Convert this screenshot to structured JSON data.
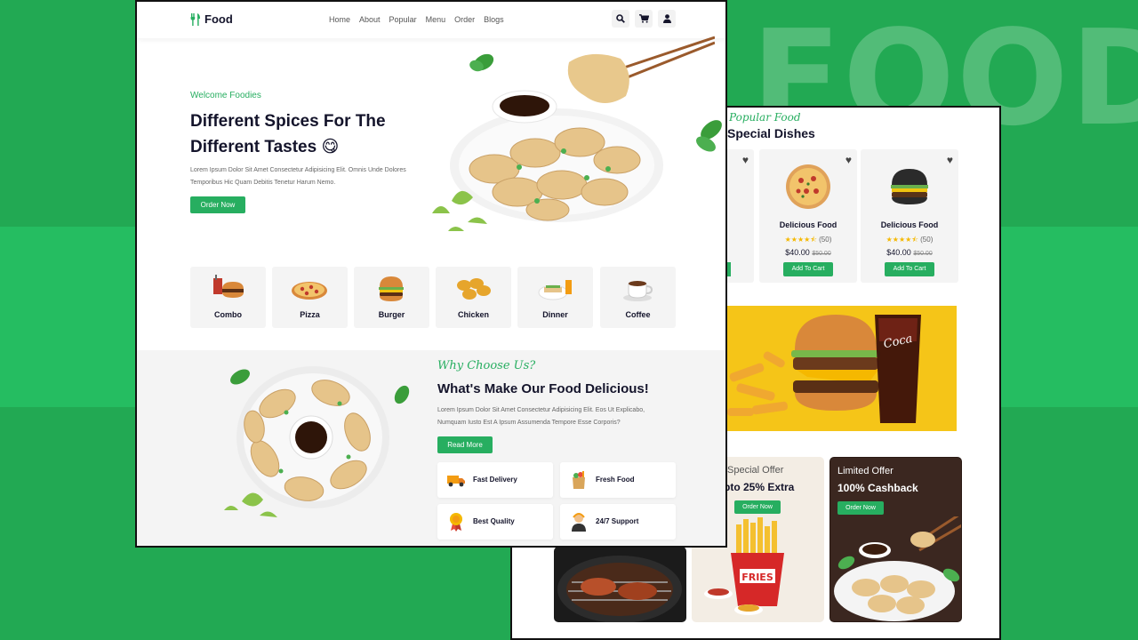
{
  "background": {
    "word": "FOOD",
    "accent": "#27ae60"
  },
  "nav": {
    "logo": "Food",
    "links": [
      "Home",
      "About",
      "Popular",
      "Menu",
      "Order",
      "Blogs"
    ],
    "icons": [
      "search-icon",
      "cart-icon",
      "user-icon"
    ]
  },
  "hero": {
    "welcome": "Welcome Foodies",
    "title_line1": "Different Spices For The",
    "title_line2": "Different Tastes",
    "emoji": "😋",
    "description_line1": "Lorem Ipsum Dolor Sit Amet Consectetur Adipisicing Elit. Omnis Unde Dolores",
    "description_line2": "Temporibus Hic Quam Debitis Tenetur Harum Nemo.",
    "button": "Order Now"
  },
  "categories": [
    "Combo",
    "Pizza",
    "Burger",
    "Chicken",
    "Dinner",
    "Coffee"
  ],
  "why": {
    "script": "Why Choose Us?",
    "title": "What's Make Our Food Delicious!",
    "description_line1": "Lorem Ipsum Dolor Sit Amet Consectetur Adipisicing Elit. Eos Ut Explicabo,",
    "description_line2": "Numquam Iusto Est A Ipsum Assumenda Tempore Esse Corporis?",
    "button": "Read More",
    "features": [
      "Fast Delivery",
      "Fresh Food",
      "Best Quality",
      "24/7 Support"
    ]
  },
  "popular": {
    "script": "Popular Food",
    "title": "Special Dishes",
    "partial_name": "d",
    "partial_rating": ")",
    "dishes": [
      {
        "name": "Delicious Food",
        "rating_count": "(50)",
        "stars": 4.5,
        "price": "$40.00",
        "old_price": "$50.00",
        "button": "Add To Cart"
      },
      {
        "name": "Delicious Food",
        "rating_count": "(50)",
        "stars": 4.5,
        "price": "$40.00",
        "old_price": "$50.00",
        "button": "Add To Cart"
      }
    ]
  },
  "offers": [
    {
      "subtitle": "Special Offer",
      "title": "pto 25% Extra",
      "button": "Order Now"
    },
    {
      "subtitle": "Limited Offer",
      "title": "100% Cashback",
      "button": "Order Now"
    }
  ]
}
